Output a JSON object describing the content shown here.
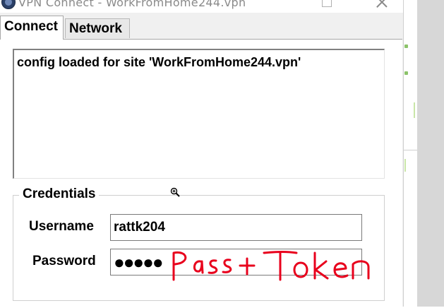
{
  "window": {
    "title": "VPN Connect - WorkFromHome244.vpn",
    "icon": "vpn-globe-icon",
    "maximize": "maximize-icon",
    "close": "close-icon"
  },
  "tabs": [
    {
      "label": "Connect",
      "selected": true
    },
    {
      "label": "Network",
      "selected": false
    }
  ],
  "log": {
    "lines": [
      "config loaded for site 'WorkFromHome244.vpn'"
    ]
  },
  "credentials": {
    "group_title": "Credentials",
    "username_label": "Username",
    "username_value": "rattk204",
    "password_label": "Password",
    "password_masked": "●●●●●"
  },
  "annotation": {
    "text": "Pass + token",
    "color": "#e8001c"
  },
  "colors": {
    "window_bg": "#f0f0f0",
    "panel_bg": "#ffffff",
    "annotation_red": "#e8001c"
  }
}
